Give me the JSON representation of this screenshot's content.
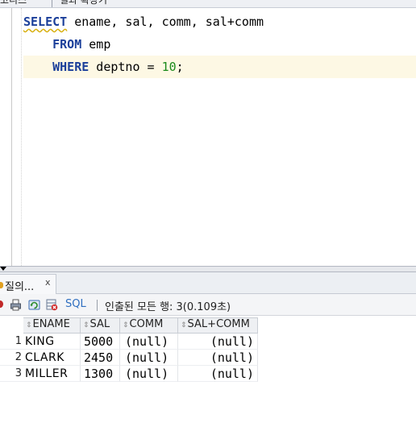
{
  "top_tabs": [
    "코디스",
    "결과 확장기"
  ],
  "editor": {
    "lines": [
      {
        "keyword": "SELECT",
        "rest": " ename, sal, comm, sal+comm"
      },
      {
        "keyword": "FROM",
        "rest": " emp"
      },
      {
        "keyword": "WHERE",
        "rest_before_num": " deptno = ",
        "number": "10",
        "rest_after_num": ";"
      }
    ]
  },
  "results": {
    "tab_label": "질의...",
    "tab_close": "x",
    "toolbar": {
      "sql_label": "SQL",
      "status_text": "인출된 모든 행: 3(0.109초)"
    },
    "columns": [
      "ENAME",
      "SAL",
      "COMM",
      "SAL+COMM"
    ],
    "rows": [
      {
        "num": "1",
        "ename": "KING",
        "sal": "5000",
        "comm": "(null)",
        "salcomm": "(null)"
      },
      {
        "num": "2",
        "ename": "CLARK",
        "sal": "2450",
        "comm": "(null)",
        "salcomm": "(null)"
      },
      {
        "num": "3",
        "ename": "MILLER",
        "sal": "1300",
        "comm": "(null)",
        "salcomm": "(null)"
      }
    ]
  },
  "colors": {
    "keyword": "#1b3f9a",
    "number": "#1a8a1a",
    "current_line": "#fdf8e4",
    "sql_link": "#2f6fc0"
  },
  "icons": [
    "pin-icon",
    "print-icon",
    "refresh-icon",
    "clear-icon",
    "sort-icon",
    "splitter-arrow-icon"
  ]
}
